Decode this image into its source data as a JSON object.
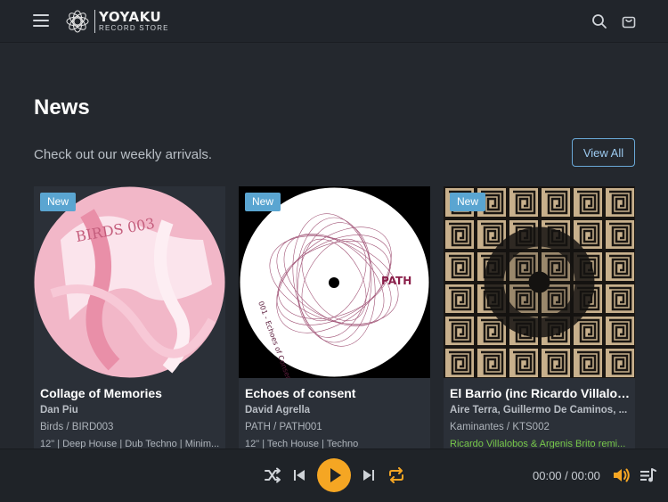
{
  "header": {
    "brand_name": "YOYAKU",
    "brand_sub": "RECORD STORE",
    "icons": [
      "menu-icon",
      "logo-icon",
      "search-icon",
      "cart-icon"
    ]
  },
  "main": {
    "title": "News",
    "subtitle": "Check out our weekly arrivals.",
    "view_all_label": "View All"
  },
  "cards": [
    {
      "badge": "New",
      "title": "Collage of Memories",
      "artist": "Dan Piu",
      "label": "Birds / BIRD003",
      "tags": "12\" | Deep House | Dub Techno | Minim..."
    },
    {
      "badge": "New",
      "title": "Echoes of consent",
      "artist": "David Agrella",
      "label": "PATH / PATH001",
      "tags": "12\" | Tech House | Techno"
    },
    {
      "badge": "New",
      "title": "El Barrio (inc Ricardo Villalob...",
      "artist": "Aire Terra, Guillermo De Caminos, ...",
      "label": "Kaminantes / KTS002",
      "tags": "Ricardo Villalobos & Argenis Brito remi..."
    }
  ],
  "player": {
    "time": "00:00 / 00:00",
    "icons": [
      "shuffle-icon",
      "previous-icon",
      "play-icon",
      "next-icon",
      "repeat-icon",
      "volume-icon",
      "playlist-icon"
    ]
  },
  "colors": {
    "background": "#24282e",
    "accent_orange": "#f5a623",
    "badge_blue": "#5aa5d1",
    "link_green": "#77c84a"
  }
}
